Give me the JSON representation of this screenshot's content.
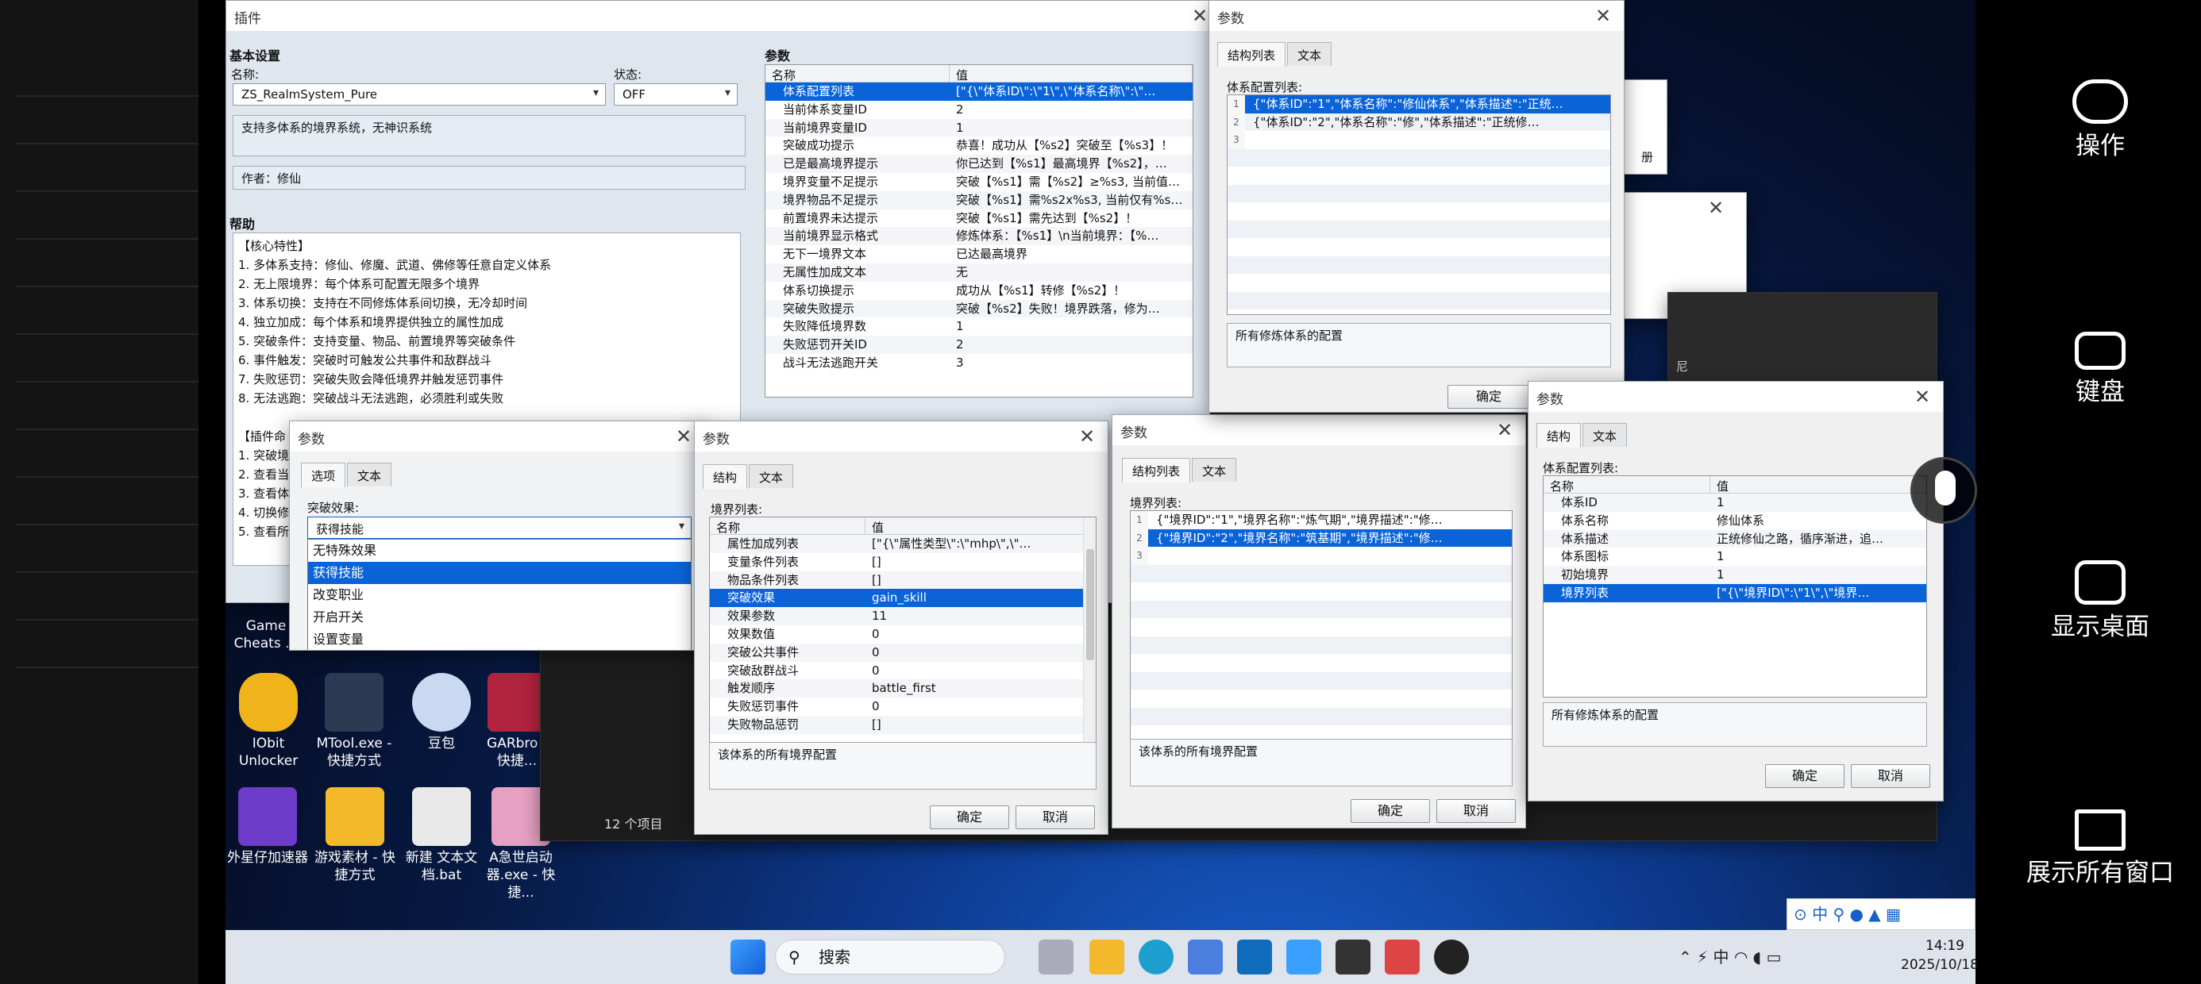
{
  "plugin": {
    "title": "插件",
    "basic_header": "基本设置",
    "name_label": "名称:",
    "status_label": "状态:",
    "name_value": "ZS_RealmSystem_Pure",
    "status_value": "OFF",
    "description": "支持多体系的境界系统，无神识系统",
    "author": "作者：修仙",
    "help_header": "帮助",
    "help_lines": [
      "【核心特性】",
      "1. 多体系支持：修仙、修魔、武道、佛修等任意自定义体系",
      "2. 无上限境界：每个体系可配置无限多个境界",
      "3. 体系切换：支持在不同修炼体系间切换，无冷却时间",
      "4. 独立加成：每个体系和境界提供独立的属性加成",
      "5. 突破条件：支持变量、物品、前置境界等突破条件",
      "6. 事件触发：突破时可触发公共事件和敌群战斗",
      "7. 失败惩罚：突破失败会降低境界并触发惩罚事件",
      "8. 无法逃跑：突破战斗无法逃跑，必须胜利或失败",
      "",
      "【插件命",
      "1. 突破境",
      "2. 查看当",
      "3. 查看体",
      "4. 切换修",
      "5. 查看所"
    ],
    "params_header": "参数",
    "col_name": "名称",
    "col_value": "值",
    "params": [
      {
        "n": "体系配置列表",
        "v": "[\"{\\\"体系ID\\\":\\\"1\\\",\\\"体系名称\\\":\\\"…"
      },
      {
        "n": "当前体系变量ID",
        "v": "2"
      },
      {
        "n": "当前境界变量ID",
        "v": "1"
      },
      {
        "n": "突破成功提示",
        "v": "恭喜！成功从【%s2】突破至【%s3】！"
      },
      {
        "n": "已是最高境界提示",
        "v": "你已达到【%s1】最高境界【%s2】，…"
      },
      {
        "n": "境界变量不足提示",
        "v": "突破【%s1】需【%s2】≥%s3, 当前值…"
      },
      {
        "n": "境界物品不足提示",
        "v": "突破【%s1】需%s2x%s3, 当前仅有%s…"
      },
      {
        "n": "前置境界未达提示",
        "v": "突破【%s1】需先达到【%s2】！"
      },
      {
        "n": "当前境界显示格式",
        "v": "修炼体系：【%s1】\\n当前境界：【%…"
      },
      {
        "n": "无下一境界文本",
        "v": "已达最高境界"
      },
      {
        "n": "无属性加成文本",
        "v": "无"
      },
      {
        "n": "体系切换提示",
        "v": "成功从【%s1】转修【%s2】！"
      },
      {
        "n": "突破失败提示",
        "v": "突破【%s2】失败！境界跌落，修为…"
      },
      {
        "n": "失败降低境界数",
        "v": "1"
      },
      {
        "n": "失败惩罚开关ID",
        "v": "2"
      },
      {
        "n": "战斗无法逃跑开关",
        "v": "3"
      }
    ]
  },
  "dlg_effect": {
    "title": "参数",
    "tab_options": "选项",
    "tab_text": "文本",
    "label": "突破效果:",
    "selected": "获得技能",
    "options": [
      "无特殊效果",
      "获得技能",
      "改变职业",
      "开启开关",
      "设置变量"
    ]
  },
  "dlg_realm": {
    "title": "参数",
    "tab_struct": "结构",
    "tab_text": "文本",
    "label": "境界列表:",
    "rows": [
      {
        "n": "属性加成列表",
        "v": "[\"{\\\"属性类型\\\":\\\"mhp\\\",\\\"…"
      },
      {
        "n": "变量条件列表",
        "v": "[]"
      },
      {
        "n": "物品条件列表",
        "v": "[]"
      },
      {
        "n": "突破效果",
        "v": "gain_skill"
      },
      {
        "n": "效果参数",
        "v": "11"
      },
      {
        "n": "效果数值",
        "v": "0"
      },
      {
        "n": "突破公共事件",
        "v": "0"
      },
      {
        "n": "突破敌群战斗",
        "v": "0"
      },
      {
        "n": "触发顺序",
        "v": "battle_first"
      },
      {
        "n": "失败惩罚事件",
        "v": "0"
      },
      {
        "n": "失败物品惩罚",
        "v": "[]"
      }
    ],
    "note": "该体系的所有境界配置",
    "ok": "确定",
    "cancel": "取消"
  },
  "dlg_realm_list": {
    "title": "参数",
    "tab_struct": "结构列表",
    "tab_text": "文本",
    "label": "境界列表:",
    "rows": [
      "{\"境界ID\":\"1\",\"境界名称\":\"炼气期\",\"境界描述\":\"修…",
      "{\"境界ID\":\"2\",\"境界名称\":\"筑基期\",\"境界描述\":\"修…"
    ],
    "nums": [
      "1",
      "2",
      "3"
    ],
    "note": "该体系的所有境界配置",
    "ok": "确定",
    "cancel": "取消"
  },
  "dlg_system_list": {
    "title": "参数",
    "tab_struct": "结构列表",
    "tab_text": "文本",
    "label": "体系配置列表:",
    "rows": [
      "{\"体系ID\":\"1\",\"体系名称\":\"修仙体系\",\"体系描述\":\"正统…",
      "{\"体系ID\":\"2\",\"体系名称\":\"修\",\"体系描述\":\"正统修…"
    ],
    "nums": [
      "1",
      "2",
      "3"
    ],
    "note": "所有修炼体系的配置",
    "ok": "确定"
  },
  "dlg_system": {
    "title": "参数",
    "tab_struct": "结构",
    "tab_text": "文本",
    "label": "体系配置列表:",
    "rows": [
      {
        "n": "体系ID",
        "v": "1"
      },
      {
        "n": "体系名称",
        "v": "修仙体系"
      },
      {
        "n": "体系描述",
        "v": "正统修仙之路，循序渐进，追…"
      },
      {
        "n": "体系图标",
        "v": "1"
      },
      {
        "n": "初始境界",
        "v": "1"
      },
      {
        "n": "境界列表",
        "v": "[\"{\\\"境界ID\\\":\\\"1\\\",\\\"境界…"
      }
    ],
    "note": "所有修炼体系的配置",
    "ok": "确定",
    "cancel": "取消"
  },
  "desktop": {
    "icons": [
      "Game Cheats ...",
      "IObit Unlocker",
      "MTool.exe - 快捷方式",
      "豆包",
      "GARbro - 快捷...",
      "外星仔加速器",
      "游戏素材 - 快捷方式",
      "新建 文本文档.bat",
      "A急世启动器.exe - 快捷..."
    ],
    "explorer_status": "12 个项目",
    "partial_text": "册",
    "hidden_text": "尼"
  },
  "taskbar": {
    "search": "搜索",
    "ime": "中",
    "time": "14:19",
    "date": "2025/10/18"
  },
  "side": {
    "items": [
      "操作",
      "键盘",
      "显示桌面",
      "展示所有窗口"
    ]
  },
  "colors": {
    "selection": "#0a64d8",
    "accent": "#1a66d8"
  }
}
